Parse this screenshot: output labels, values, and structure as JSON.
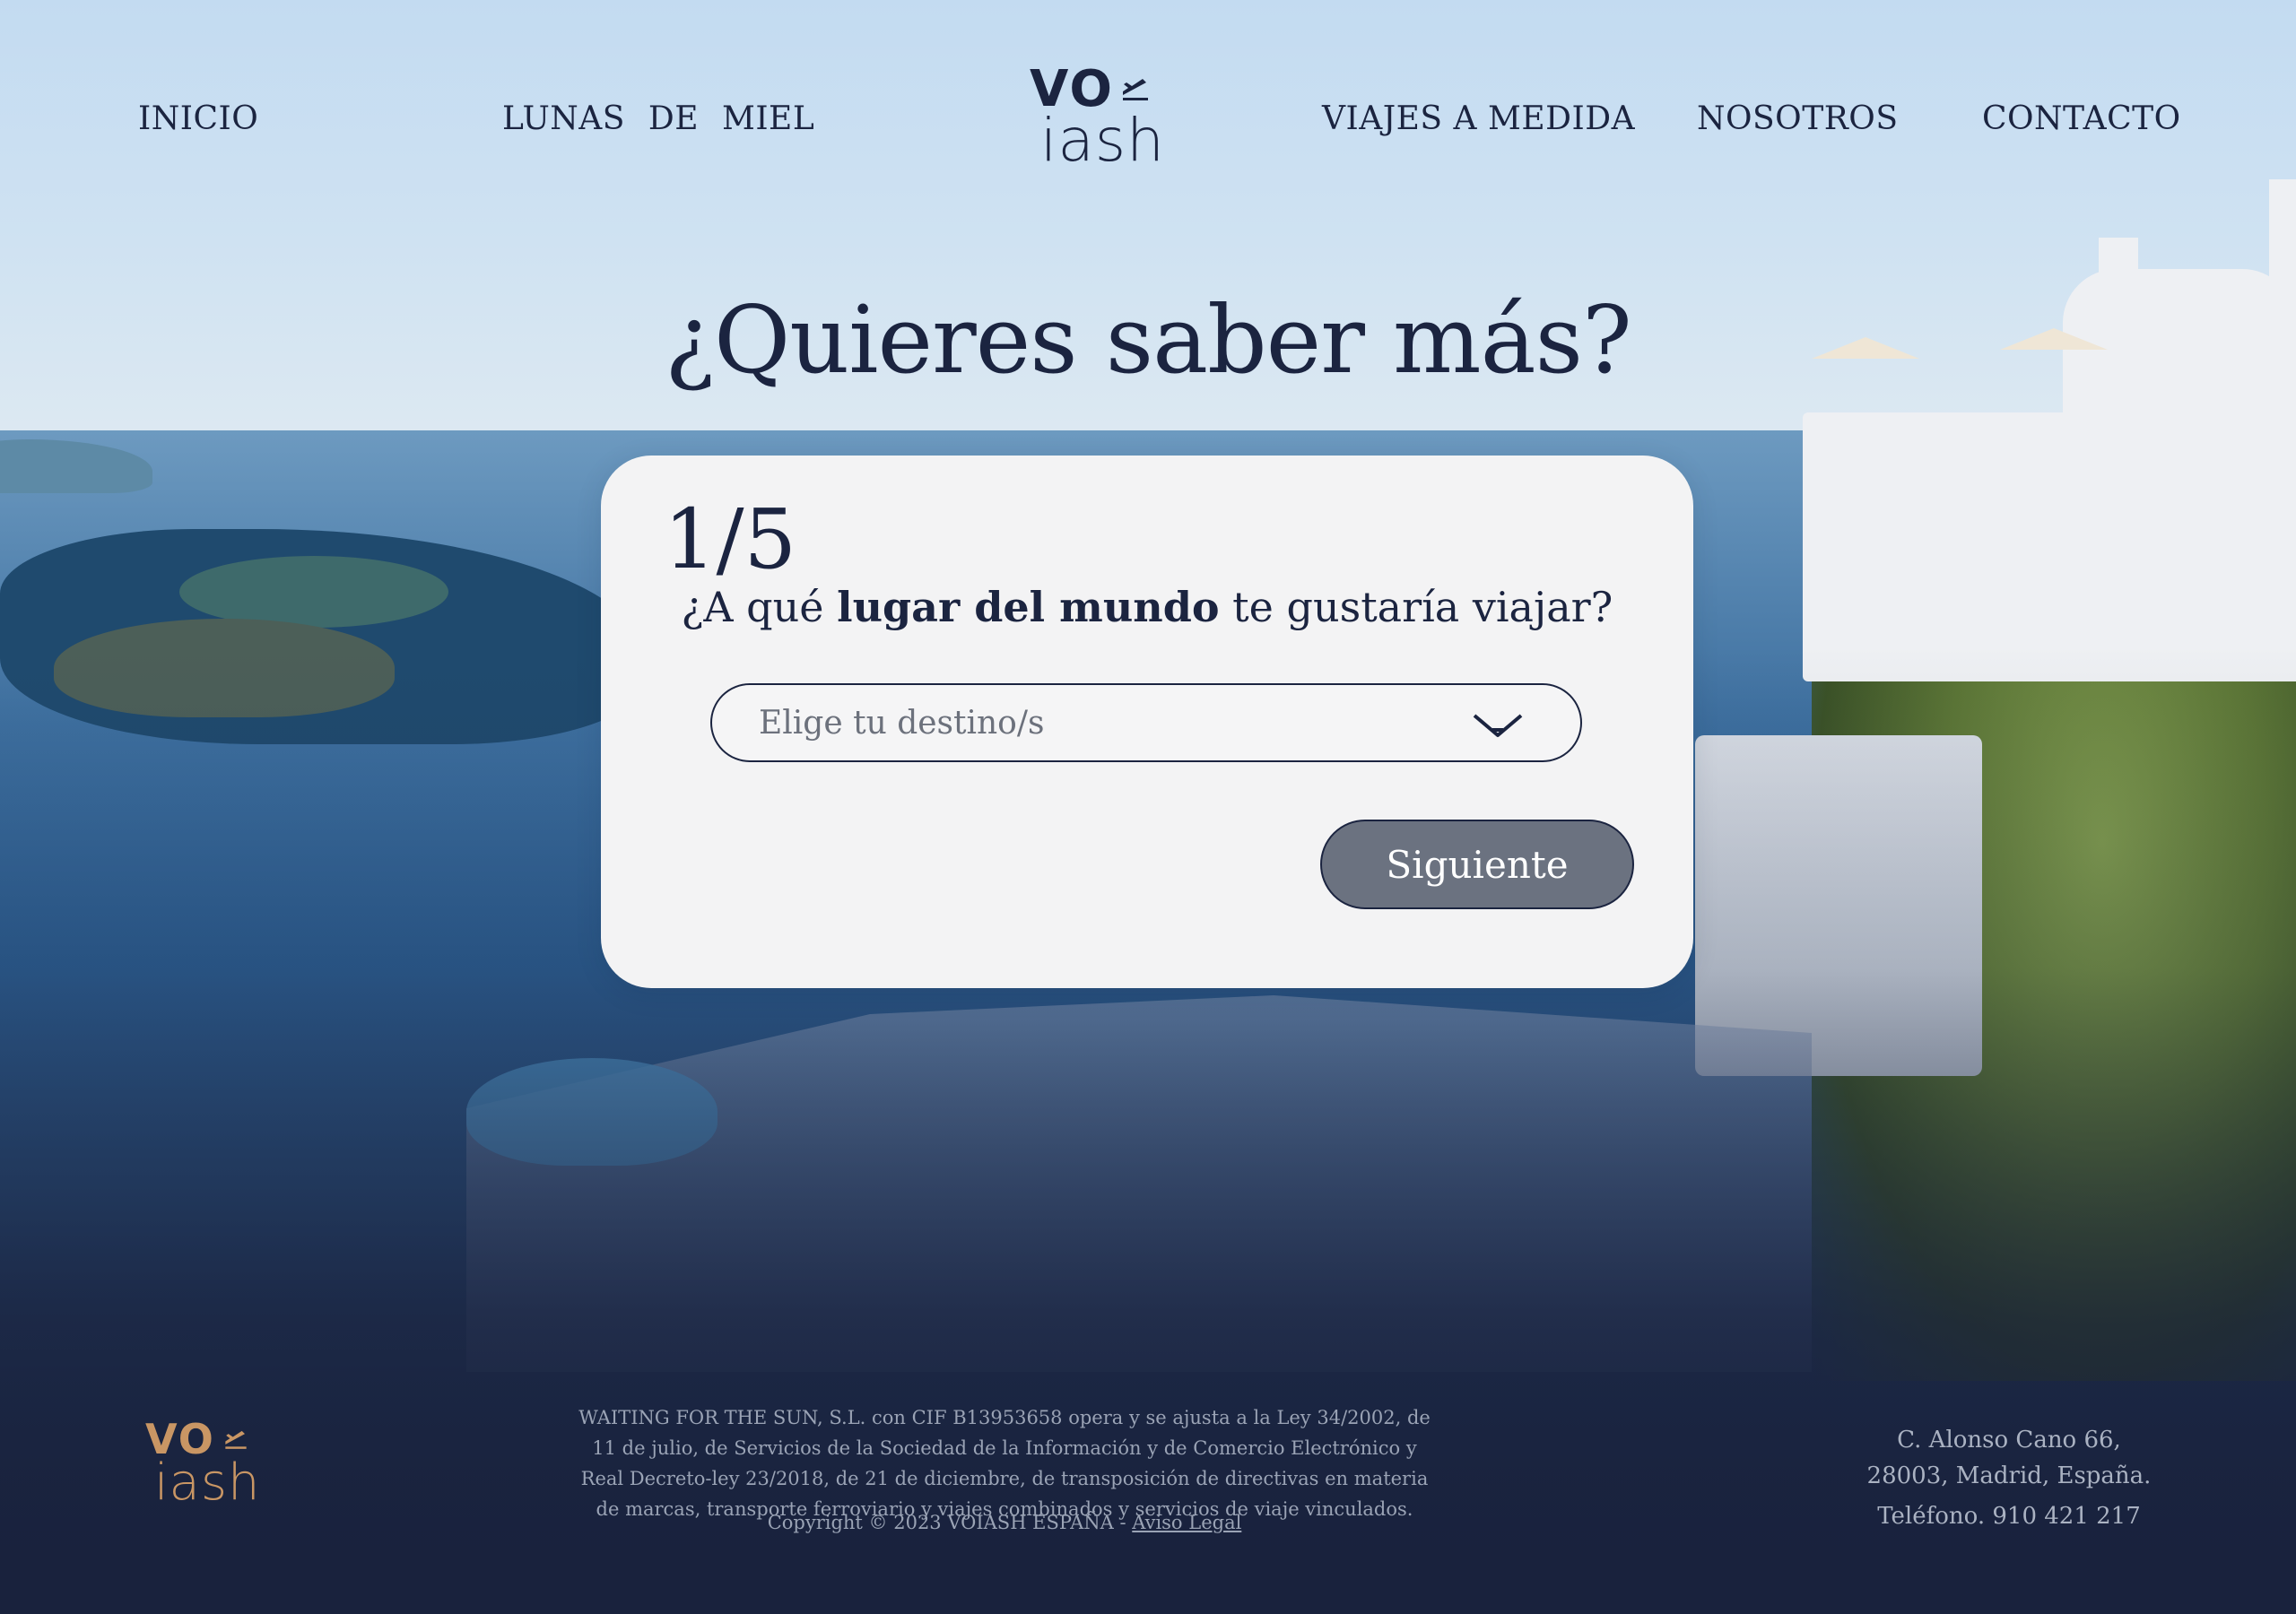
{
  "nav": {
    "items": [
      {
        "label": "INICIO"
      },
      {
        "label": "LUNAS DE MIEL"
      },
      {
        "label": "VIAJES A MEDIDA"
      },
      {
        "label": "NOSOTROS"
      },
      {
        "label": "CONTACTO"
      }
    ]
  },
  "brand": {
    "logo_top": "VO",
    "logo_bottom": "iash",
    "logo_icon": "plane-icon",
    "primary_color": "#1b2440",
    "accent_color": "#c99664"
  },
  "hero": {
    "title": "¿Quieres saber más?"
  },
  "form": {
    "step": "1/5",
    "question_prefix": "¿A qué ",
    "question_bold": "lugar del mundo",
    "question_suffix": " te gustaría viajar?",
    "select_placeholder": "Elige tu destino/s",
    "select_icon": "chevron-down-icon",
    "next_label": "Siguiente",
    "next_button_color": "#6b7280"
  },
  "footer": {
    "legal_text": "WAITING FOR THE SUN, S.L. con CIF B13953658 opera y se ajusta a la Ley 34/2002, de 11 de julio, de Servicios de la Sociedad de la Información y de Comercio Electrónico y Real Decreto-ley 23/2018, de 21 de diciembre, de transposición de directivas en materia de marcas, transporte ferroviario y viajes combinados y servicios de viaje vinculados.",
    "copyright": "Copyright © 2023 VOIASH ESPAÑA - ",
    "legal_link": "Aviso Legal",
    "address_line1": "C. Alonso Cano 66,",
    "address_line2": "28003, Madrid, España.",
    "phone": "Teléfono. 910 421 217"
  }
}
